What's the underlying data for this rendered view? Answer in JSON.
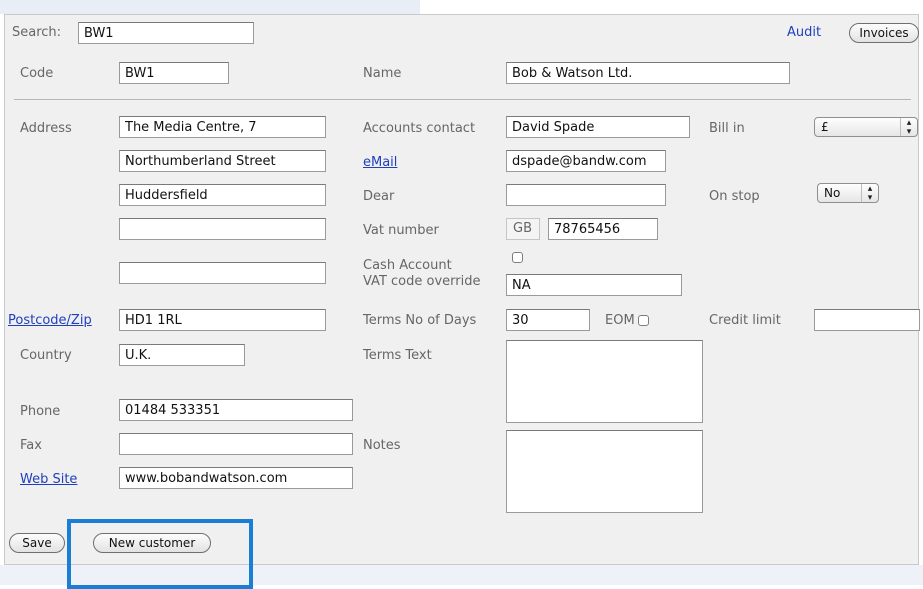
{
  "header": {
    "search_label": "Search:",
    "search_value": "BW1",
    "audit_link": "Audit",
    "invoices_button": "Invoices"
  },
  "top": {
    "code_label": "Code",
    "code_value": "BW1",
    "name_label": "Name",
    "name_value": "Bob & Watson Ltd."
  },
  "address": {
    "label": "Address",
    "line1": "The Media Centre, 7",
    "line2": "Northumberland Street",
    "line3": "Huddersfield",
    "line4": "",
    "line5": "",
    "postcode_link": "Postcode/Zip",
    "postcode_value": "HD1 1RL",
    "country_label": "Country",
    "country_value": "U.K.",
    "phone_label": "Phone",
    "phone_value": "01484 533351",
    "fax_label": "Fax",
    "fax_value": "",
    "website_link": "Web Site",
    "website_value": "www.bobandwatson.com"
  },
  "accounts": {
    "contact_label": "Accounts contact",
    "contact_value": "David Spade",
    "email_link": "eMail",
    "email_value": "dspade@bandw.com",
    "dear_label": "Dear",
    "dear_value": "",
    "vat_label": "Vat number",
    "vat_prefix": "GB",
    "vat_value": "78765456",
    "cash_account_label": "Cash Account",
    "cash_account_checked": false,
    "vat_override_label": "VAT code override",
    "vat_override_value": "NA",
    "terms_days_label": "Terms No of Days",
    "terms_days_value": "30",
    "eom_label": "EOM",
    "eom_checked": false,
    "terms_text_label": "Terms Text",
    "terms_text_value": "",
    "notes_label": "Notes",
    "notes_value": ""
  },
  "billing": {
    "bill_in_label": "Bill in",
    "bill_in_value": "£",
    "on_stop_label": "On stop",
    "on_stop_value": "No",
    "credit_limit_label": "Credit limit",
    "credit_limit_value": ""
  },
  "footer": {
    "save_button": "Save",
    "new_customer_button": "New customer"
  },
  "colors": {
    "link": "#1f3fbf",
    "highlight": "#1a7fd4",
    "panel": "#f0f0f0"
  }
}
